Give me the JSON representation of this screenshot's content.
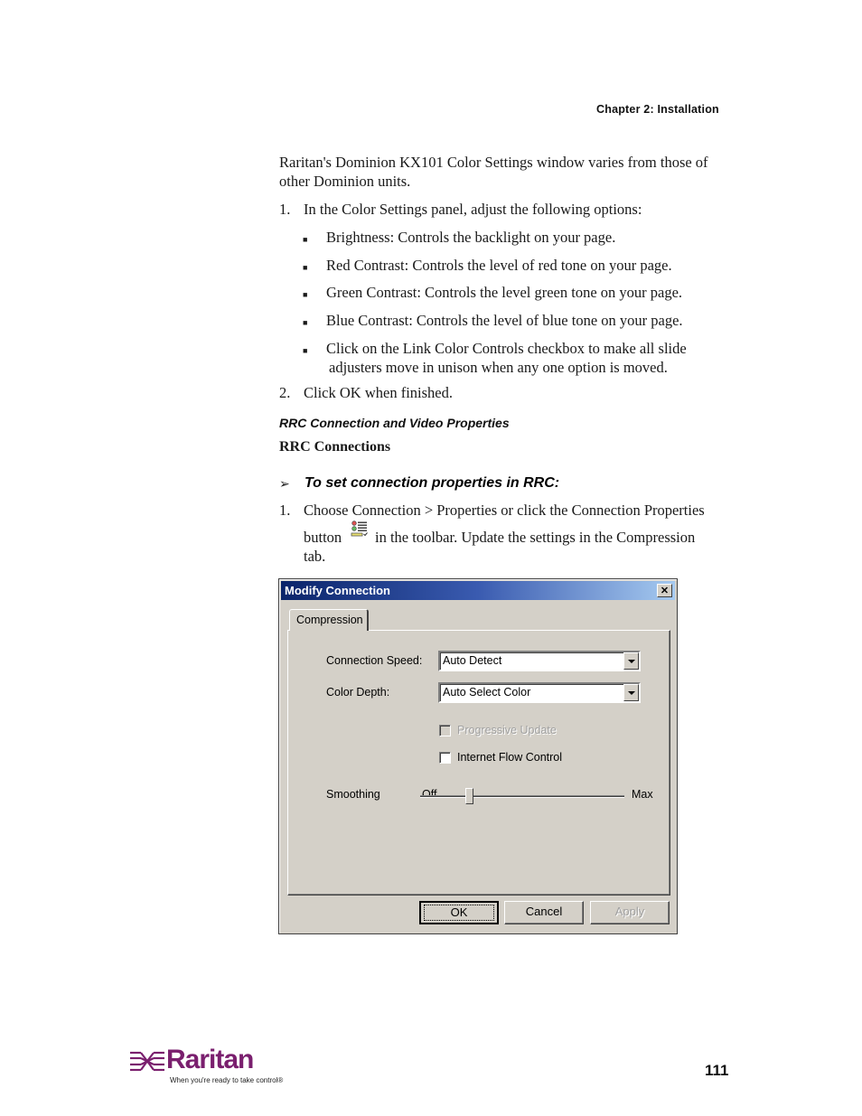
{
  "header": {
    "chapter": "Chapter 2: Installation"
  },
  "intro": "Raritan's Dominion KX101 Color Settings window varies from those of other Dominion units.",
  "steps_color": [
    {
      "num": "1.",
      "text": "In the Color Settings panel, adjust the following options:"
    },
    {
      "num": "2.",
      "text": "Click OK when finished."
    }
  ],
  "bullets": [
    "Brightness: Controls the backlight on your page.",
    "Red Contrast: Controls the level of red tone on your page.",
    "Green Contrast: Controls the level green tone on your page.",
    "Blue Contrast: Controls the level of blue tone on your page.",
    "Click on the Link Color Controls checkbox to make all slide",
    "adjusters move in unison when any one option is moved."
  ],
  "section_heading": "RRC Connection and Video Properties",
  "subsection_heading": "RRC Connections",
  "procedure_title": "To set connection properties in RRC:",
  "procedure_step": {
    "num": "1.",
    "line1": "Choose Connection > Properties or click the Connection Properties",
    "line2_before_icon": "button",
    "line2_after_icon": "in the toolbar. Update the settings in the Compression",
    "line3": "tab."
  },
  "dialog": {
    "title": "Modify Connection",
    "close_glyph": "✕",
    "tab": "Compression",
    "connection_speed_label": "Connection Speed:",
    "connection_speed_value": "Auto Detect",
    "color_depth_label": "Color Depth:",
    "color_depth_value": "Auto Select Color",
    "progressive_update_label": "Progressive Update",
    "progressive_update_checked": false,
    "progressive_update_enabled": false,
    "internet_flow_control_label": "Internet Flow Control",
    "internet_flow_control_checked": false,
    "smoothing_label": "Smoothing",
    "smoothing_min": "Off",
    "smoothing_max": "Max",
    "smoothing_level": 0.24,
    "ok": "OK",
    "cancel": "Cancel",
    "apply": "Apply"
  },
  "footer": {
    "brand": "Raritan",
    "tagline": "When you're ready to take control®",
    "page_number": "111",
    "brand_color": "#7a1f6e"
  }
}
